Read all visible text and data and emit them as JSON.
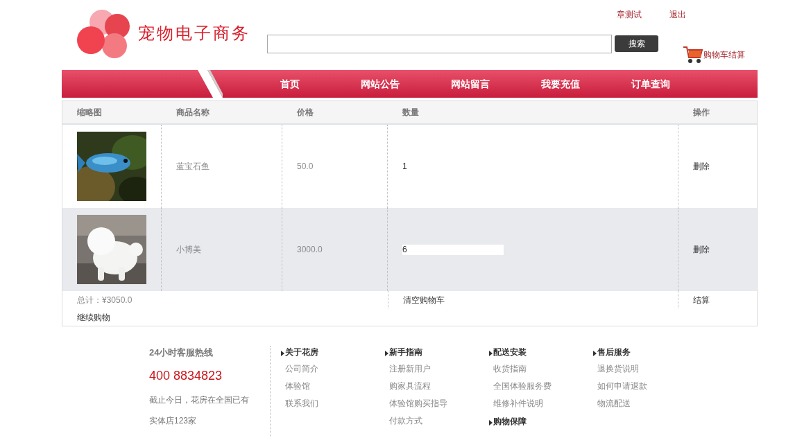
{
  "header": {
    "logo_text": "宠物电子商务",
    "user_links": [
      {
        "label": "章测试"
      },
      {
        "label": "退出"
      }
    ],
    "search": {
      "button": "搜索"
    },
    "cart_link": "购物车结算"
  },
  "nav": [
    {
      "label": "首页"
    },
    {
      "label": "网站公告"
    },
    {
      "label": "网站留言"
    },
    {
      "label": "我要充值"
    },
    {
      "label": "订单查询"
    }
  ],
  "cart_table": {
    "columns": [
      "缩略图",
      "商品名称",
      "价格",
      "数量",
      "操作"
    ],
    "rows": [
      {
        "name": "蓝宝石鱼",
        "price": "50.0",
        "quantity": "1",
        "action": "删除",
        "hovered": false
      },
      {
        "name": "小博美",
        "price": "3000.0",
        "quantity": "6",
        "action": "删除",
        "hovered": true
      }
    ],
    "total": "总计：¥3050.0",
    "clear": "清空购物车",
    "checkout": "结算",
    "continue": "继续购物"
  },
  "footer": {
    "hotline": {
      "title": "24小时客服热线",
      "phone": "400 8834823",
      "lines": [
        "截止今日，花房在全国已有",
        "实体店123家"
      ]
    },
    "columns": [
      {
        "sections": [
          {
            "title": "关于花房",
            "links": [
              "公司简介",
              "体验馆",
              "联系我们"
            ]
          }
        ]
      },
      {
        "sections": [
          {
            "title": "新手指南",
            "links": [
              "注册新用户",
              "购家具流程",
              "体验馆购买指导",
              "付款方式"
            ]
          }
        ]
      },
      {
        "sections": [
          {
            "title": "配送安装",
            "links": [
              "收货指南",
              "全国体验服务费",
              "维修补件说明"
            ]
          },
          {
            "title": "购物保障"
          }
        ]
      },
      {
        "sections": [
          {
            "title": "售后服务",
            "links": [
              "退换货说明",
              "如何申请退款",
              "物流配送"
            ]
          }
        ]
      }
    ]
  }
}
